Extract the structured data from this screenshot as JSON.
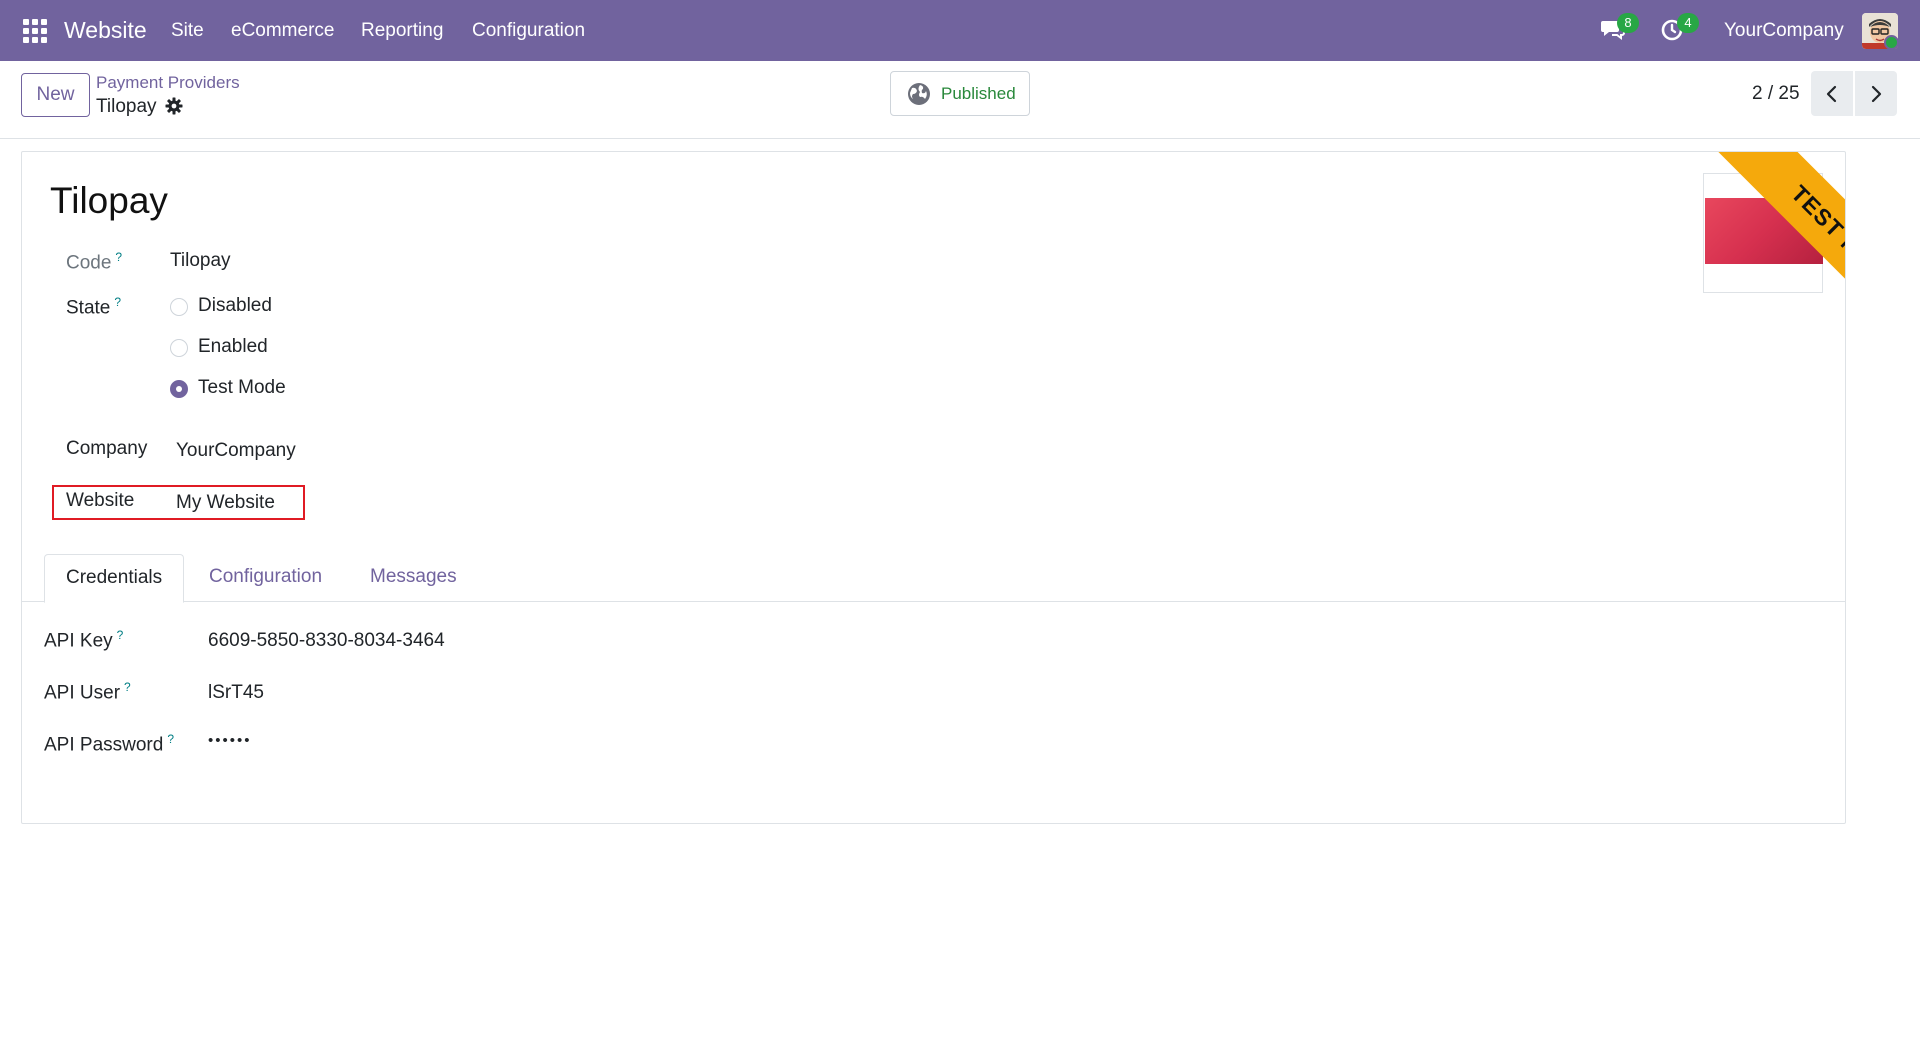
{
  "navbar": {
    "app_name": "Website",
    "menus": [
      "Site",
      "eCommerce",
      "Reporting",
      "Configuration"
    ],
    "messages_count": "8",
    "activities_count": "4",
    "company": "YourCompany"
  },
  "control_panel": {
    "new_label": "New",
    "breadcrumb_parent": "Payment Providers",
    "breadcrumb_current": "Tilopay",
    "published_label": "Published",
    "pager": "2 / 25"
  },
  "form": {
    "title": "Tilopay",
    "ribbon": "TEST MODE",
    "code_label": "Code",
    "code_value": "Tilopay",
    "state_label": "State",
    "state_options": [
      "Disabled",
      "Enabled",
      "Test Mode"
    ],
    "state_selected": "Test Mode",
    "company_label": "Company",
    "company_value": "YourCompany",
    "website_label": "Website",
    "website_value": "My Website",
    "help_mark": "?"
  },
  "tabs": [
    "Credentials",
    "Configuration",
    "Messages"
  ],
  "credentials": {
    "api_key_label": "API Key",
    "api_key_value": "6609-5850-8330-8034-3464",
    "api_user_label": "API User",
    "api_user_value": "lSrT45",
    "api_password_label": "API Password",
    "api_password_value": "••••••"
  },
  "colors": {
    "brand": "#71639e",
    "published": "#28883a",
    "ribbon": "#f5a90c",
    "highlight": "#e01b24",
    "badge": "#28a745"
  }
}
